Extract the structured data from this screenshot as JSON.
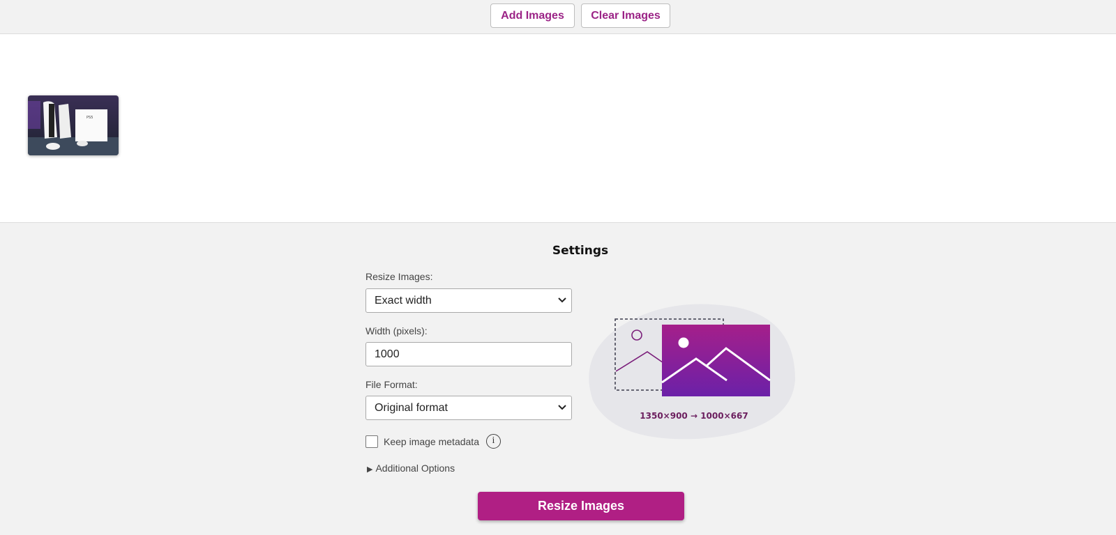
{
  "toolbar": {
    "add_label": "Add Images",
    "clear_label": "Clear Images"
  },
  "gallery": {
    "thumbnails": [
      {
        "caption": "PS5"
      }
    ]
  },
  "settings": {
    "title": "Settings",
    "resize_label": "Resize Images:",
    "resize_value": "Exact width",
    "width_label": "Width (pixels):",
    "width_value": "1000",
    "format_label": "File Format:",
    "format_value": "Original format",
    "metadata_label": "Keep image metadata",
    "metadata_checked": false,
    "info_glyph": "i",
    "additional_label": "Additional Options",
    "additional_arrow": "▶"
  },
  "illustration": {
    "dimensions": "1350×900 → 1000×667"
  },
  "action": {
    "resize_label": "Resize Images"
  },
  "colors": {
    "accent": "#b01f84",
    "gradient_top": "#a51f8a",
    "gradient_bottom": "#6b21a8"
  }
}
